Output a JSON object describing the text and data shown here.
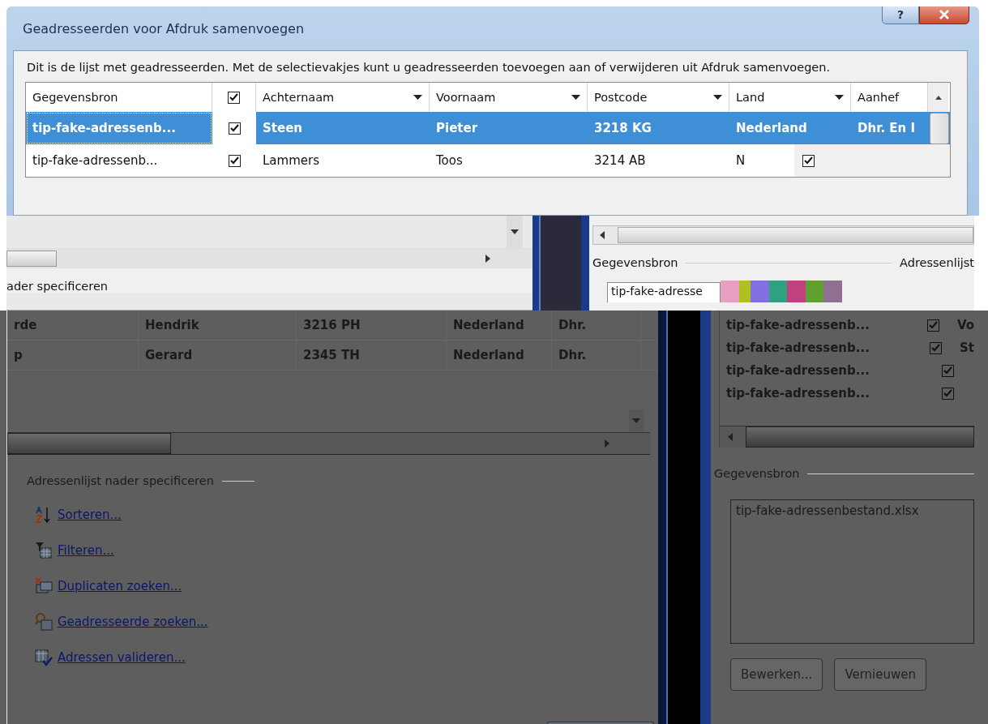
{
  "dialog": {
    "title": "Geadresseerden voor Afdruk samenvoegen",
    "help_button": "?",
    "description": "Dit is de lijst met geadresseerden. Met de selectievakjes kunt u geadresseerden toevoegen aan of verwijderen uit Afdruk samenvoegen.",
    "source_column": "Gegevensbron",
    "check_column": {
      "checked": true
    },
    "columns": [
      {
        "kind": "sortable",
        "label": "Achternaam"
      },
      {
        "kind": "sortable",
        "label": "Voornaam"
      },
      {
        "kind": "sortable",
        "label": "Postcode"
      },
      {
        "kind": "sortable",
        "label": "Land"
      },
      {
        "kind": "text",
        "label": "Aanhef"
      }
    ],
    "rows": [
      {
        "selected": true,
        "source": "tip-fake-adressenb...",
        "checked": true,
        "cells": [
          "Steen",
          "Pieter",
          "3218 KG",
          "Nederland",
          "Dhr. En I"
        ]
      },
      {
        "selected": false,
        "source": "tip-fake-adressenb...",
        "checked": true,
        "cells": [
          "Lammers",
          "Toos",
          "3214 AB",
          "N"
        ],
        "fragment_checked": true
      }
    ]
  },
  "fragment": {
    "section_label": "ader specificeren",
    "source_label": "Gegevensbron",
    "list_label": "Adressenlijst",
    "source_field": "tip-fake-adresse"
  },
  "background_left": {
    "rows": [
      {
        "cells": [
          "rde",
          "Hendrik",
          "3216 PH",
          "Nederland",
          "Dhr."
        ]
      },
      {
        "cells": [
          "p",
          "Gerard",
          "2345 TH",
          "Nederland",
          "Dhr."
        ]
      }
    ],
    "section_title": "Adressenlijst nader specificeren",
    "links": [
      {
        "label": "Sorteren..."
      },
      {
        "label": "Filteren..."
      },
      {
        "label": "Duplicaten zoeken..."
      },
      {
        "label": "Geadresseerde zoeken..."
      },
      {
        "label": "Adressen valideren..."
      }
    ]
  },
  "background_right": {
    "rows": [
      {
        "source": "tip-fake-adressenb...",
        "checked": true,
        "column_3": "Vo"
      },
      {
        "source": "tip-fake-adressenb...",
        "checked": true,
        "column_3": "St"
      },
      {
        "source": "tip-fake-adressenb...",
        "checked": true
      },
      {
        "source": "tip-fake-adressenb...",
        "checked": true
      }
    ],
    "source_title": "Gegevensbron",
    "source_list": [
      "tip-fake-adressenbestand.xlsx"
    ],
    "buttons": [
      "Bewerken...",
      "Vernieuwen"
    ]
  }
}
